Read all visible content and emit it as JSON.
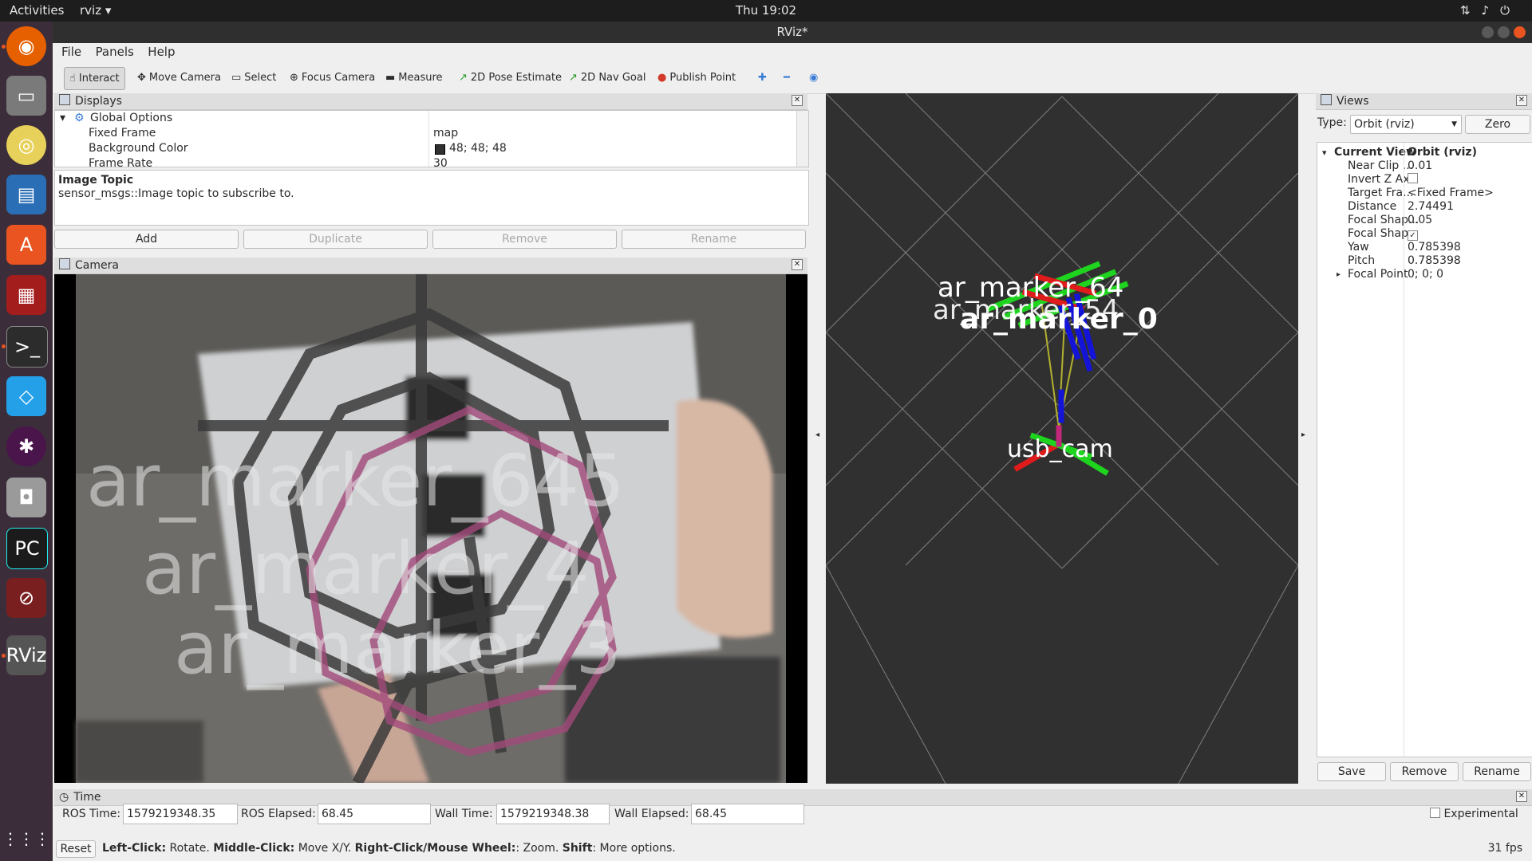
{
  "topbar": {
    "activities": "Activities",
    "app_menu": "rviz ▾",
    "clock": "Thu 19:02"
  },
  "window": {
    "title": "RViz*"
  },
  "menu": [
    "File",
    "Panels",
    "Help"
  ],
  "toolbar": {
    "interact": "Interact",
    "move_camera": "Move Camera",
    "select": "Select",
    "focus_camera": "Focus Camera",
    "measure": "Measure",
    "pose_estimate": "2D Pose Estimate",
    "nav_goal": "2D Nav Goal",
    "publish_point": "Publish Point"
  },
  "displays": {
    "title": "Displays",
    "global_options": "Global Options",
    "rows": [
      {
        "name": "Fixed Frame",
        "value": "map"
      },
      {
        "name": "Background Color",
        "value": "48; 48; 48"
      },
      {
        "name": "Frame Rate",
        "value": "30"
      }
    ],
    "desc_title": "Image Topic",
    "desc_text": "sensor_msgs::Image topic to subscribe to.",
    "buttons": {
      "add": "Add",
      "duplicate": "Duplicate",
      "remove": "Remove",
      "rename": "Rename"
    }
  },
  "camera": {
    "title": "Camera",
    "overlay_labels": [
      "ar_marker_645",
      "ar_marker_4",
      "ar_marker_3"
    ]
  },
  "view3d": {
    "marker_labels": [
      "ar_marker_64",
      "ar_marker_54",
      "ar_marker_0"
    ],
    "cam_label": "usb_cam"
  },
  "views": {
    "title": "Views",
    "type_label": "Type:",
    "type_value": "Orbit (rviz)",
    "zero": "Zero",
    "current_view": "Current View",
    "current_view_value": "Orbit (rviz)",
    "rows": [
      {
        "name": "Near Clip ...",
        "value": "0.01"
      },
      {
        "name": "Invert Z Axis",
        "value": ""
      },
      {
        "name": "Target Fra...",
        "value": "<Fixed Frame>"
      },
      {
        "name": "Distance",
        "value": "2.74491"
      },
      {
        "name": "Focal Shap...",
        "value": "0.05"
      },
      {
        "name": "Focal Shap...",
        "value": "✓"
      },
      {
        "name": "Yaw",
        "value": "0.785398"
      },
      {
        "name": "Pitch",
        "value": "0.785398"
      },
      {
        "name": "Focal Point",
        "value": "0; 0; 0"
      }
    ],
    "save": "Save",
    "remove": "Remove",
    "rename": "Rename"
  },
  "time": {
    "title": "Time",
    "ros_time_label": "ROS Time:",
    "ros_time": "1579219348.35",
    "ros_elapsed_label": "ROS Elapsed:",
    "ros_elapsed": "68.45",
    "wall_time_label": "Wall Time:",
    "wall_time": "1579219348.38",
    "wall_elapsed_label": "Wall Elapsed:",
    "wall_elapsed": "68.45",
    "experimental": "Experimental"
  },
  "status": {
    "reset": "Reset",
    "left_click": "Left-Click:",
    "left_click_action": " Rotate. ",
    "middle_click": "Middle-Click:",
    "middle_click_action": " Move X/Y. ",
    "right_click": "Right-Click/Mouse Wheel:",
    "right_click_action": ": Zoom. ",
    "shift": "Shift",
    "shift_action": ": More options.",
    "fps": "31 fps"
  },
  "colors": {
    "topbar": "#1d1d1d",
    "dock": "#3b2e3a",
    "render_bg": "#303030",
    "axis_red": "#e01b1b",
    "axis_green": "#1ed41e",
    "axis_blue": "#1414d8"
  }
}
